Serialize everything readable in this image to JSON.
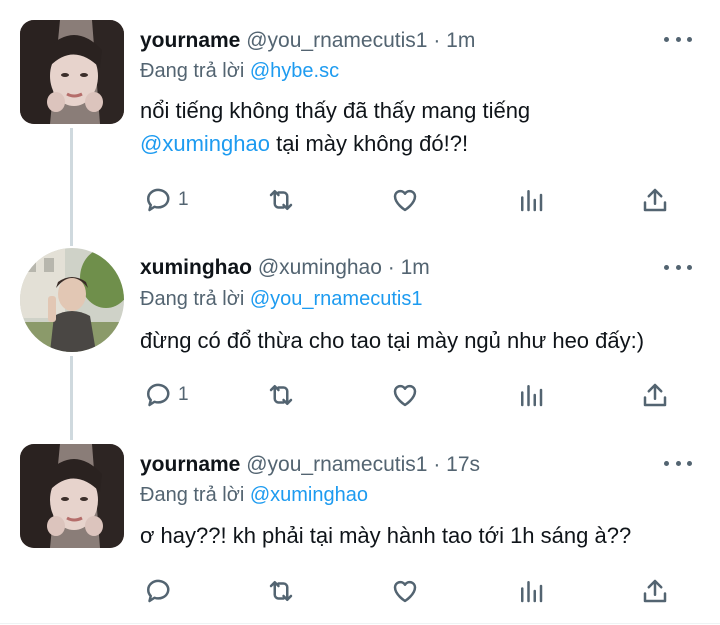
{
  "tweets": [
    {
      "name": "yourname",
      "handle": "@you_rnamecutis1",
      "dot": "·",
      "time": "1m",
      "replying_prefix": "Đang trả lời",
      "replying_to": "@hybe.sc",
      "text_line1": "nổi tiếng không thấy đã thấy mang tiếng",
      "text_mention": "@xuminghao",
      "text_rest": "tại mày không đó!?!",
      "reply_count": "1",
      "avatar": "girl-portrait-avatar"
    },
    {
      "name": "xuminghao",
      "handle": "@xuminghao",
      "dot": "·",
      "time": "1m",
      "replying_prefix": "Đang trả lời",
      "replying_to": "@you_rnamecutis1",
      "text": "đừng có đổ thừa cho tao tại mày ngủ như heo đấy:)",
      "reply_count": "1",
      "avatar": "boy-portrait-avatar"
    },
    {
      "name": "yourname",
      "handle": "@you_rnamecutis1",
      "dot": "·",
      "time": "17s",
      "replying_prefix": "Đang trả lời",
      "replying_to": "@xuminghao",
      "text": "ơ hay??! kh phải tại mày hành tao tới 1h sáng à??",
      "reply_count": "",
      "avatar": "girl-portrait-avatar"
    }
  ],
  "colors": {
    "link": "#1d9bf0",
    "muted": "#536471",
    "text": "#0f1419",
    "thread_line": "#cfd9de"
  },
  "icons": [
    "reply-icon",
    "retweet-icon",
    "like-icon",
    "analytics-icon",
    "share-icon",
    "more-icon"
  ]
}
